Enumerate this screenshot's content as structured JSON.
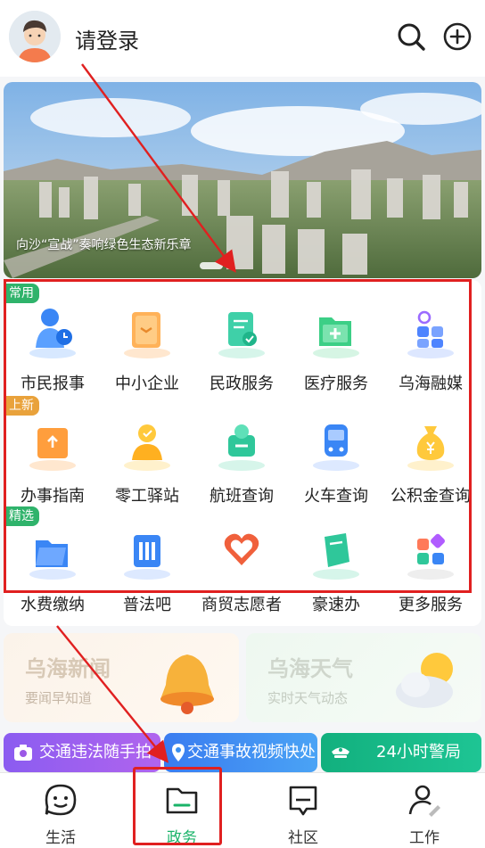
{
  "header": {
    "login_label": "请登录",
    "search_icon": "search-icon",
    "add_icon": "plus-circle-icon"
  },
  "banner": {
    "caption": "向沙“宣战”奏响绿色生态新乐章"
  },
  "services": {
    "groups": [
      {
        "tag": "常用",
        "tag_color": "#2fb36b"
      },
      {
        "tag": "上新",
        "tag_color": "#e9a23b"
      },
      {
        "tag": "精选",
        "tag_color": "#2fb36b"
      }
    ],
    "row1": [
      "市民报事",
      "中小企业",
      "民政服务",
      "医疗服务",
      "乌海融媒"
    ],
    "row2": [
      "办事指南",
      "零工驿站",
      "航班查询",
      "火车查询",
      "公积金查询"
    ],
    "row3": [
      "水费缴纳",
      "普法吧",
      "商贸志愿者",
      "豪速办",
      "更多服务"
    ]
  },
  "cards": [
    {
      "title": "乌海新闻",
      "subtitle": "要闻早知道"
    },
    {
      "title": "乌海天气",
      "subtitle": "实时天气动态"
    }
  ],
  "quick": [
    {
      "label": "交通违法随手拍",
      "color": "#9b59e6"
    },
    {
      "label": "交通事故视频快处",
      "color": "#3a8ef0"
    },
    {
      "label": "24小时警局",
      "color": "#19b383"
    }
  ],
  "tabs": [
    {
      "label": "生活",
      "icon": "smile-chat-icon"
    },
    {
      "label": "政务",
      "icon": "folder-icon"
    },
    {
      "label": "社区",
      "icon": "chat-bubble-icon"
    },
    {
      "label": "工作",
      "icon": "user-edit-icon"
    }
  ],
  "colors": {
    "accent": "#19b368",
    "highlight": "#e02020"
  }
}
